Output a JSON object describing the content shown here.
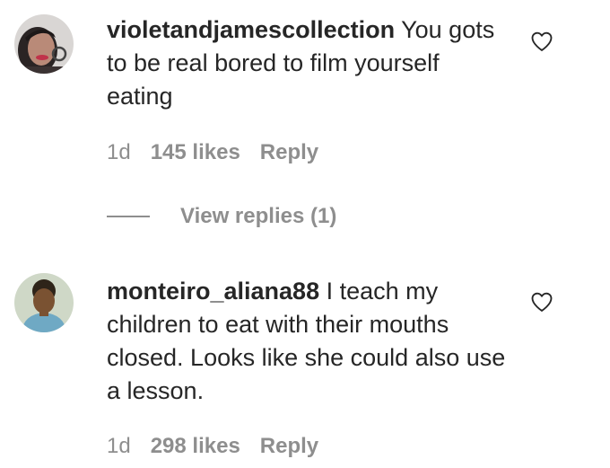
{
  "comments": [
    {
      "username": "violetandjamescollection",
      "text": " You gots to be real bored to film yourself eating",
      "time": "1d",
      "likes": "145 likes",
      "reply_label": "Reply",
      "avatar_icon": "user-avatar",
      "like_icon": "heart-outline-icon",
      "view_replies": "View replies (1)"
    },
    {
      "username": "monteiro_aliana88",
      "text": " I teach my children to eat with their mouths closed. Looks like she could also use a lesson.",
      "time": "1d",
      "likes": "298 likes",
      "reply_label": "Reply",
      "avatar_icon": "user-avatar",
      "like_icon": "heart-outline-icon"
    }
  ],
  "colors": {
    "primary_text": "#262626",
    "secondary_text": "#8e8e8e",
    "background": "#ffffff"
  }
}
